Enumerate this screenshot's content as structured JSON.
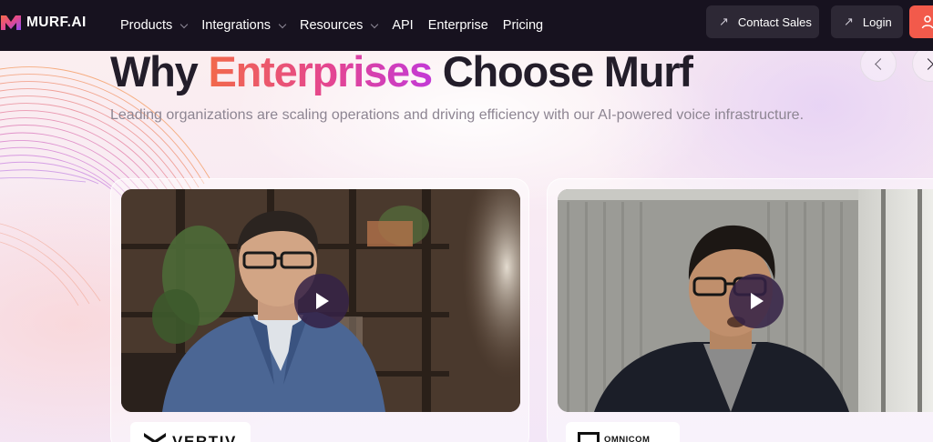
{
  "brand": {
    "name": "MURF.AI"
  },
  "nav": {
    "items": [
      {
        "label": "Products",
        "has_dropdown": true
      },
      {
        "label": "Integrations",
        "has_dropdown": true
      },
      {
        "label": "Resources",
        "has_dropdown": true
      },
      {
        "label": "API",
        "has_dropdown": false
      },
      {
        "label": "Enterprise",
        "has_dropdown": false
      },
      {
        "label": "Pricing",
        "has_dropdown": false
      }
    ],
    "contact_sales": "Contact Sales",
    "login": "Login",
    "arrow_glyph": "↗"
  },
  "hero": {
    "title_prefix": "Why ",
    "title_accent": "Enterprises",
    "title_suffix": " Choose Murf",
    "subtitle": "Leading organizations are scaling operations and driving efficiency with our AI-powered voice infrastructure."
  },
  "testimonials": [
    {
      "company_logo_text": "VERTIV",
      "video_state": "paused"
    },
    {
      "company_logo_text": "OMNICOM",
      "video_state": "paused"
    }
  ],
  "colors": {
    "nav_bg": "#17121f",
    "nav_button_bg": "#2d2835",
    "signup_accent": "#f25a4b",
    "title_text": "#231d2a",
    "accent_gradient": [
      "#f2694a",
      "#e44592",
      "#c33ad6"
    ],
    "subtitle_text": "#8d8592",
    "play_button": "#342246"
  },
  "icons": [
    "murf-logo-icon",
    "chevron-down-icon",
    "external-arrow-icon",
    "user-icon",
    "chevron-left-icon",
    "chevron-right-icon",
    "play-icon",
    "vertiv-logo-icon",
    "omnicom-logo-icon"
  ]
}
